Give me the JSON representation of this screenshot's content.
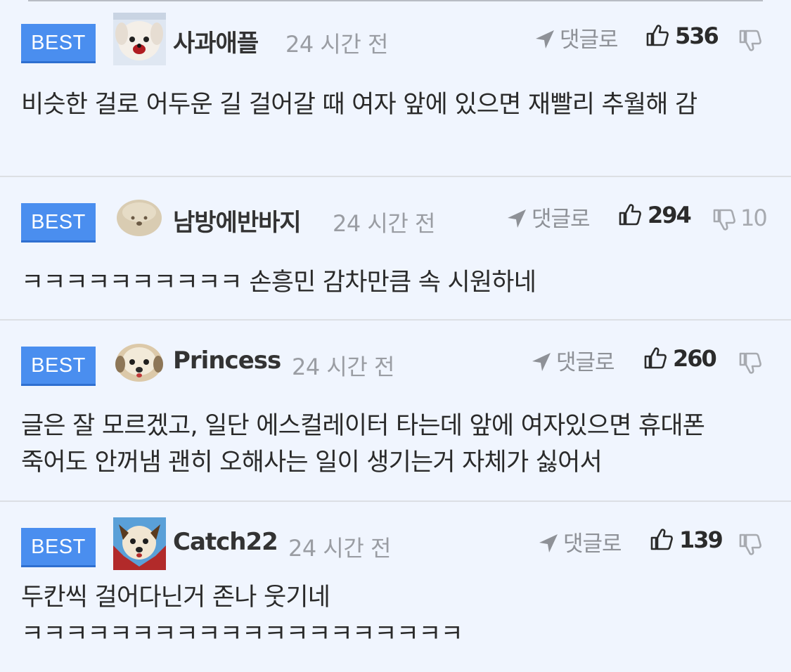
{
  "comments": [
    {
      "badge": "BEST",
      "author": "사과애플",
      "avatar": "puppy-avatar-white-red",
      "time": "24 시간 전",
      "reply_label": "댓글로",
      "likes": "536",
      "dislikes": "",
      "text": "비슷한 걸로 어두운 길 걸어갈 때 여자 앞에 있으면 재빨리 추월해 감"
    },
    {
      "badge": "BEST",
      "author": "남방에반바지",
      "avatar": "puppy-avatar-beige",
      "time": "24 시간 전",
      "reply_label": "댓글로",
      "likes": "294",
      "dislikes": "10",
      "text": "ㅋㅋㅋㅋㅋㅋㅋㅋㅋㅋ 손흥민 감차만큼 속 시원하네"
    },
    {
      "badge": "BEST",
      "author": "Princess",
      "avatar": "puppy-avatar-round",
      "time": "24 시간 전",
      "reply_label": "댓글로",
      "likes": "260",
      "dislikes": "",
      "text": "글은 잘 모르겠고, 일단 에스컬레이터 타는데 앞에 여자있으면 휴대폰 죽어도 안꺼냄 괜히 오해사는 일이 생기는거 자체가 싫어서"
    },
    {
      "badge": "BEST",
      "author": "Catch22",
      "avatar": "puppy-avatar-blue-red",
      "time": "24 시간 전",
      "reply_label": "댓글로",
      "likes": "139",
      "dislikes": "",
      "text": "두칸씩 걸어다닌거 존나 웃기네 ㅋㅋㅋㅋㅋㅋㅋㅋㅋㅋㅋㅋㅋㅋㅋㅋㅋㅋㅋㅋ"
    }
  ],
  "colors": {
    "background": "#f0f5fe",
    "badge": "#4a8eef",
    "divider": "#dcdfe4"
  }
}
